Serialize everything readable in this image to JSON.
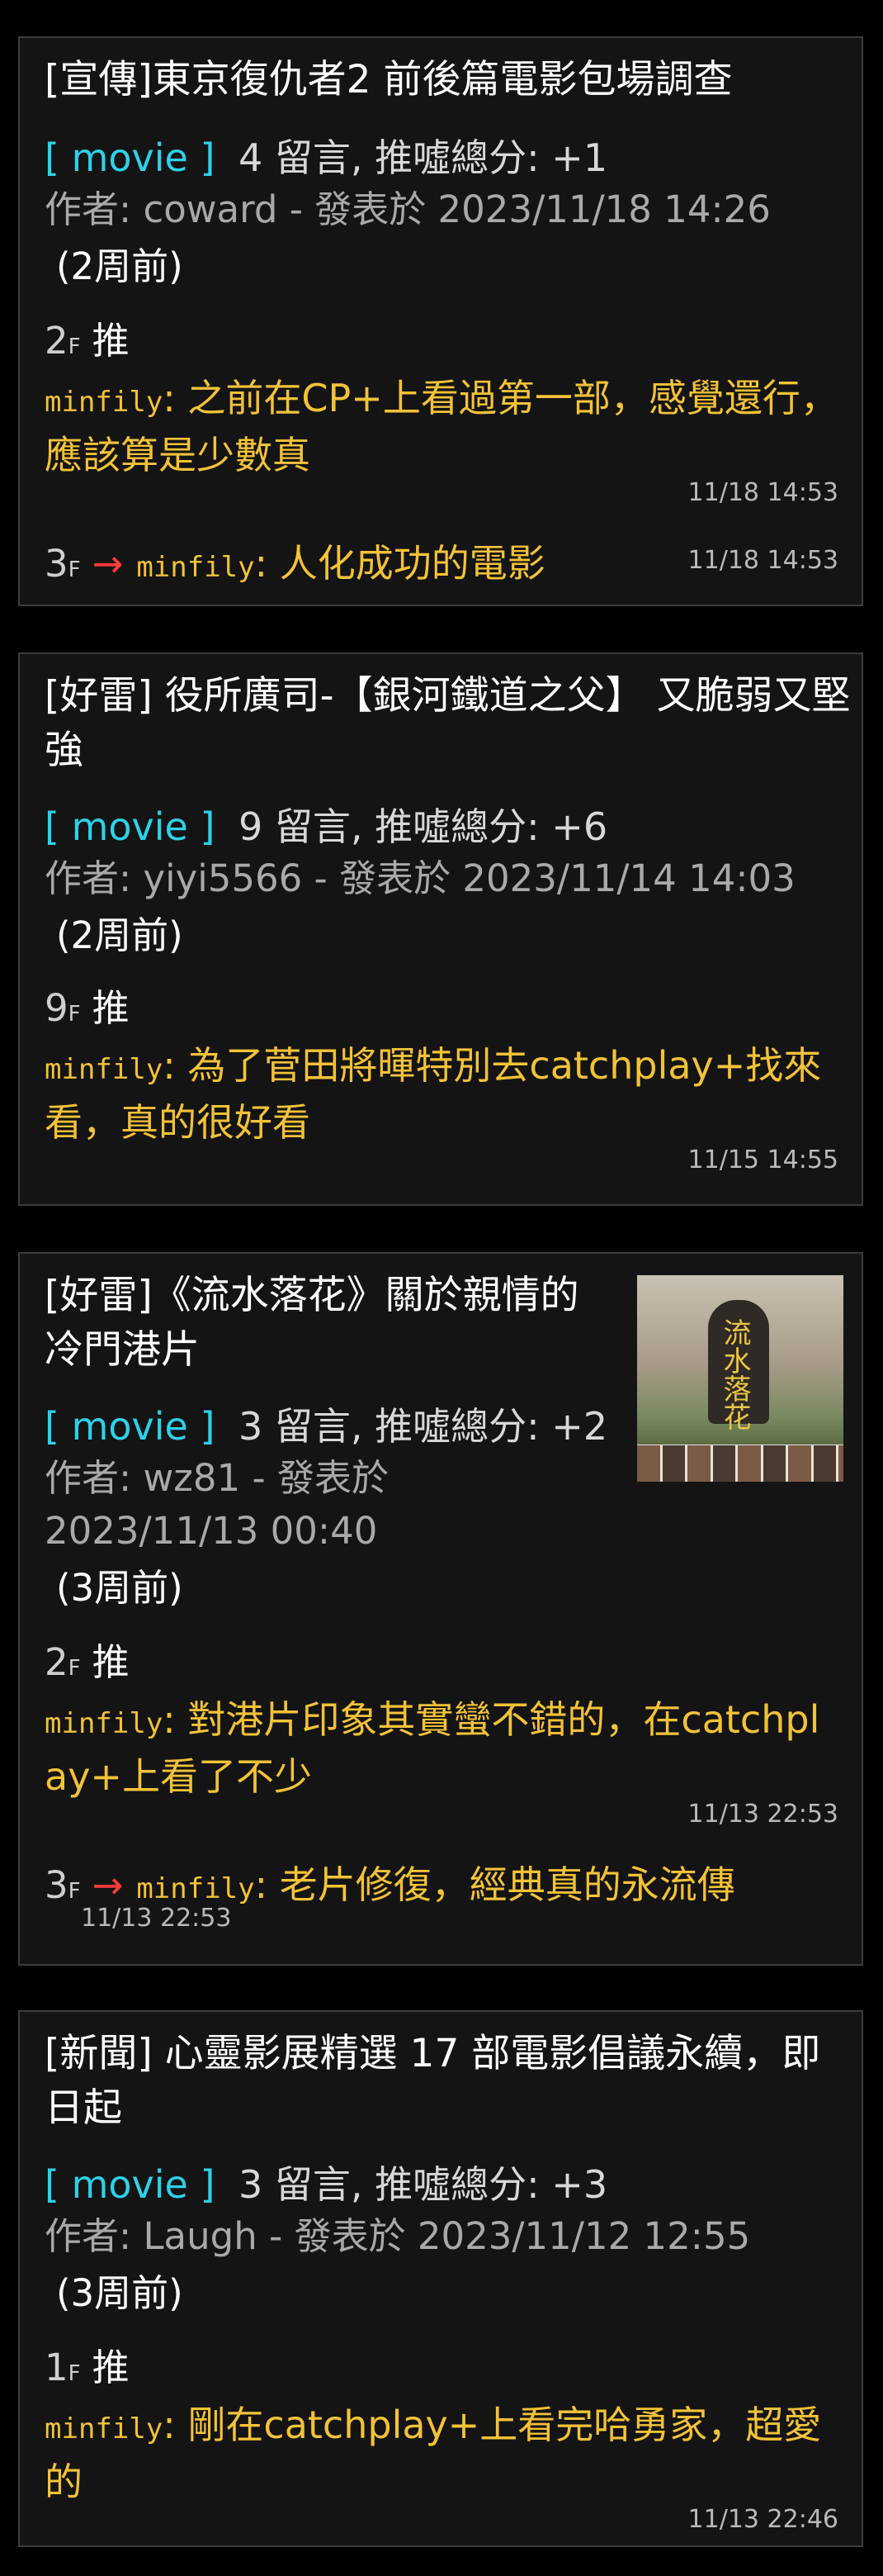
{
  "posts": [
    {
      "title": "[宣傳]東京復仇者2 前後篇電影包場調查",
      "board": "[ movie ]",
      "summary": "4 留言, 推噓總分: +1",
      "info": "作者: coward - 發表於 2023/11/18 14:26",
      "ago": "(2周前)",
      "comments": [
        {
          "floor": "2",
          "floor_suffix": "F",
          "tag": "推",
          "user": "minfily",
          "text": ": 之前在CP+上看過第一部，感覺還行，應該算是少數真",
          "time": "11/18 14:53"
        },
        {
          "floor": "3",
          "floor_suffix": "F",
          "tag": "→",
          "user": "minfily",
          "text": ": 人化成功的電影",
          "time": "11/18 14:53"
        }
      ]
    },
    {
      "title": "[好雷] 役所廣司-【銀河鐵道之父】 又脆弱又堅強",
      "board": "[ movie ]",
      "summary": "9 留言, 推噓總分: +6",
      "info": "作者: yiyi5566 - 發表於 2023/11/14 14:03",
      "ago": "(2周前)",
      "comments": [
        {
          "floor": "9",
          "floor_suffix": "F",
          "tag": "推",
          "user": "minfily",
          "text": ": 為了菅田將暉特別去catchplay+找來看，真的很好看",
          "time": "11/15 14:55"
        }
      ]
    },
    {
      "title": "[好雷]《流水落花》關於親情的冷門港片",
      "board": "[ movie ]",
      "summary": "3 留言, 推噓總分: +2",
      "info": "作者: wz81 - 發表於 2023/11/13 00:40",
      "ago": "(3周前)",
      "thumbnail_text": "流水落花",
      "comments": [
        {
          "floor": "2",
          "floor_suffix": "F",
          "tag": "推",
          "user": "minfily",
          "text": ": 對港片印象其實蠻不錯的，在catchplay+上看了不少",
          "time": "11/13 22:53"
        },
        {
          "floor": "3",
          "floor_suffix": "F",
          "tag": "→",
          "user": "minfily",
          "text": ": 老片修復，經典真的永流傳",
          "time": "11/13 22:53"
        }
      ]
    },
    {
      "title": "[新聞] 心靈影展精選 17 部電影倡議永續，即日起",
      "board": "[ movie ]",
      "summary": "3 留言, 推噓總分: +3",
      "info": "作者: Laugh - 發表於 2023/11/12 12:55",
      "ago": "(3周前)",
      "comments": [
        {
          "floor": "1",
          "floor_suffix": "F",
          "tag": "推",
          "user": "minfily",
          "text": ": 剛在catchplay+上看完哈勇家，超愛的",
          "time": "11/13 22:46"
        }
      ]
    }
  ],
  "colors": {
    "background": "#000000",
    "card": "#141414",
    "board": "#2ed1e8",
    "comment": "#f2c238",
    "arrow": "#ff3b3b"
  }
}
